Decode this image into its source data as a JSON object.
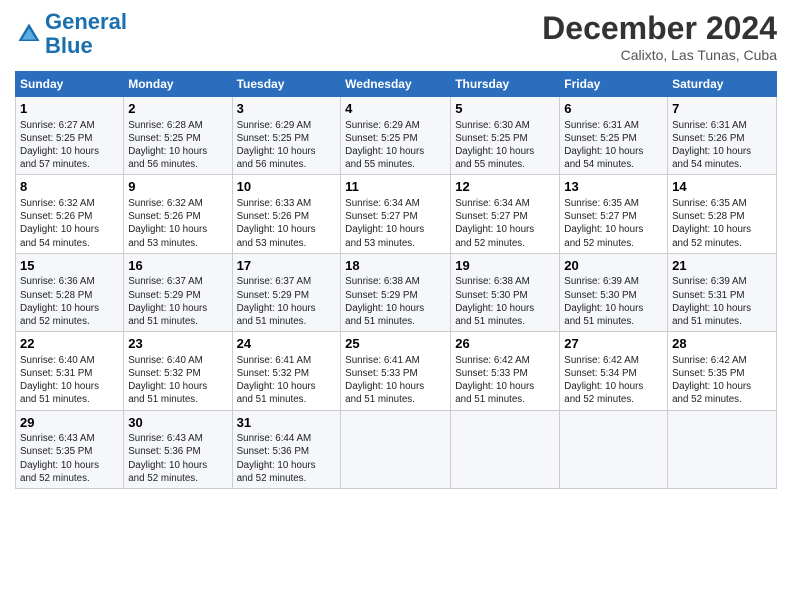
{
  "header": {
    "logo_line1": "General",
    "logo_line2": "Blue",
    "month": "December 2024",
    "location": "Calixto, Las Tunas, Cuba"
  },
  "days_of_week": [
    "Sunday",
    "Monday",
    "Tuesday",
    "Wednesday",
    "Thursday",
    "Friday",
    "Saturday"
  ],
  "weeks": [
    [
      {
        "day": "1",
        "lines": [
          "Sunrise: 6:27 AM",
          "Sunset: 5:25 PM",
          "Daylight: 10 hours",
          "and 57 minutes."
        ]
      },
      {
        "day": "2",
        "lines": [
          "Sunrise: 6:28 AM",
          "Sunset: 5:25 PM",
          "Daylight: 10 hours",
          "and 56 minutes."
        ]
      },
      {
        "day": "3",
        "lines": [
          "Sunrise: 6:29 AM",
          "Sunset: 5:25 PM",
          "Daylight: 10 hours",
          "and 56 minutes."
        ]
      },
      {
        "day": "4",
        "lines": [
          "Sunrise: 6:29 AM",
          "Sunset: 5:25 PM",
          "Daylight: 10 hours",
          "and 55 minutes."
        ]
      },
      {
        "day": "5",
        "lines": [
          "Sunrise: 6:30 AM",
          "Sunset: 5:25 PM",
          "Daylight: 10 hours",
          "and 55 minutes."
        ]
      },
      {
        "day": "6",
        "lines": [
          "Sunrise: 6:31 AM",
          "Sunset: 5:25 PM",
          "Daylight: 10 hours",
          "and 54 minutes."
        ]
      },
      {
        "day": "7",
        "lines": [
          "Sunrise: 6:31 AM",
          "Sunset: 5:26 PM",
          "Daylight: 10 hours",
          "and 54 minutes."
        ]
      }
    ],
    [
      {
        "day": "8",
        "lines": [
          "Sunrise: 6:32 AM",
          "Sunset: 5:26 PM",
          "Daylight: 10 hours",
          "and 54 minutes."
        ]
      },
      {
        "day": "9",
        "lines": [
          "Sunrise: 6:32 AM",
          "Sunset: 5:26 PM",
          "Daylight: 10 hours",
          "and 53 minutes."
        ]
      },
      {
        "day": "10",
        "lines": [
          "Sunrise: 6:33 AM",
          "Sunset: 5:26 PM",
          "Daylight: 10 hours",
          "and 53 minutes."
        ]
      },
      {
        "day": "11",
        "lines": [
          "Sunrise: 6:34 AM",
          "Sunset: 5:27 PM",
          "Daylight: 10 hours",
          "and 53 minutes."
        ]
      },
      {
        "day": "12",
        "lines": [
          "Sunrise: 6:34 AM",
          "Sunset: 5:27 PM",
          "Daylight: 10 hours",
          "and 52 minutes."
        ]
      },
      {
        "day": "13",
        "lines": [
          "Sunrise: 6:35 AM",
          "Sunset: 5:27 PM",
          "Daylight: 10 hours",
          "and 52 minutes."
        ]
      },
      {
        "day": "14",
        "lines": [
          "Sunrise: 6:35 AM",
          "Sunset: 5:28 PM",
          "Daylight: 10 hours",
          "and 52 minutes."
        ]
      }
    ],
    [
      {
        "day": "15",
        "lines": [
          "Sunrise: 6:36 AM",
          "Sunset: 5:28 PM",
          "Daylight: 10 hours",
          "and 52 minutes."
        ]
      },
      {
        "day": "16",
        "lines": [
          "Sunrise: 6:37 AM",
          "Sunset: 5:29 PM",
          "Daylight: 10 hours",
          "and 51 minutes."
        ]
      },
      {
        "day": "17",
        "lines": [
          "Sunrise: 6:37 AM",
          "Sunset: 5:29 PM",
          "Daylight: 10 hours",
          "and 51 minutes."
        ]
      },
      {
        "day": "18",
        "lines": [
          "Sunrise: 6:38 AM",
          "Sunset: 5:29 PM",
          "Daylight: 10 hours",
          "and 51 minutes."
        ]
      },
      {
        "day": "19",
        "lines": [
          "Sunrise: 6:38 AM",
          "Sunset: 5:30 PM",
          "Daylight: 10 hours",
          "and 51 minutes."
        ]
      },
      {
        "day": "20",
        "lines": [
          "Sunrise: 6:39 AM",
          "Sunset: 5:30 PM",
          "Daylight: 10 hours",
          "and 51 minutes."
        ]
      },
      {
        "day": "21",
        "lines": [
          "Sunrise: 6:39 AM",
          "Sunset: 5:31 PM",
          "Daylight: 10 hours",
          "and 51 minutes."
        ]
      }
    ],
    [
      {
        "day": "22",
        "lines": [
          "Sunrise: 6:40 AM",
          "Sunset: 5:31 PM",
          "Daylight: 10 hours",
          "and 51 minutes."
        ]
      },
      {
        "day": "23",
        "lines": [
          "Sunrise: 6:40 AM",
          "Sunset: 5:32 PM",
          "Daylight: 10 hours",
          "and 51 minutes."
        ]
      },
      {
        "day": "24",
        "lines": [
          "Sunrise: 6:41 AM",
          "Sunset: 5:32 PM",
          "Daylight: 10 hours",
          "and 51 minutes."
        ]
      },
      {
        "day": "25",
        "lines": [
          "Sunrise: 6:41 AM",
          "Sunset: 5:33 PM",
          "Daylight: 10 hours",
          "and 51 minutes."
        ]
      },
      {
        "day": "26",
        "lines": [
          "Sunrise: 6:42 AM",
          "Sunset: 5:33 PM",
          "Daylight: 10 hours",
          "and 51 minutes."
        ]
      },
      {
        "day": "27",
        "lines": [
          "Sunrise: 6:42 AM",
          "Sunset: 5:34 PM",
          "Daylight: 10 hours",
          "and 52 minutes."
        ]
      },
      {
        "day": "28",
        "lines": [
          "Sunrise: 6:42 AM",
          "Sunset: 5:35 PM",
          "Daylight: 10 hours",
          "and 52 minutes."
        ]
      }
    ],
    [
      {
        "day": "29",
        "lines": [
          "Sunrise: 6:43 AM",
          "Sunset: 5:35 PM",
          "Daylight: 10 hours",
          "and 52 minutes."
        ]
      },
      {
        "day": "30",
        "lines": [
          "Sunrise: 6:43 AM",
          "Sunset: 5:36 PM",
          "Daylight: 10 hours",
          "and 52 minutes."
        ]
      },
      {
        "day": "31",
        "lines": [
          "Sunrise: 6:44 AM",
          "Sunset: 5:36 PM",
          "Daylight: 10 hours",
          "and 52 minutes."
        ]
      },
      null,
      null,
      null,
      null
    ]
  ]
}
